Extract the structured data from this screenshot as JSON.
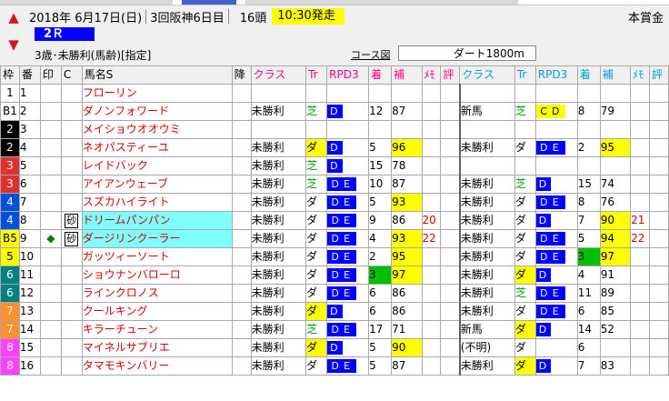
{
  "header": {
    "date": "2018年 6月17日(日)",
    "meeting": "3回阪神6日目",
    "heads": "16頭",
    "start_time": "10:30発走",
    "prize": "本賞金",
    "race_number": "2Ｒ",
    "condition": "3歳･未勝利(馬齢)[指定]",
    "course_label": "コース図",
    "course": "ダート1800m"
  },
  "columns": {
    "waku": "枠",
    "ban": "番",
    "mark": "印",
    "c": "C",
    "name": "馬名S",
    "kou": "降",
    "class1": "クラス",
    "tr1": "Tr",
    "rd1": "RPD3",
    "chaku1": "着",
    "ho1": "補",
    "memo1": "ﾒﾓ",
    "hyo1": "評",
    "class2": "クラス",
    "tr2": "Tr",
    "rd2": "RPD3",
    "chaku2": "着",
    "ho2": "補",
    "memo2": "ﾒﾓ",
    "hyo2": "評"
  },
  "colors": {
    "waku": [
      "#ffffff",
      "#000000",
      "#e03030",
      "#0050e0",
      "#ffff00",
      "#008080",
      "#ff9030",
      "#ff40ff"
    ],
    "waku_text": [
      "#000000",
      "#ffffff",
      "#ffffff",
      "#ffffff",
      "#000000",
      "#ffffff",
      "#ffffff",
      "#ffffff"
    ]
  },
  "rows": [
    {
      "waku": "1",
      "wc": 0,
      "ban": "1",
      "mark": "",
      "c": "",
      "name": "フローリン",
      "hl": false,
      "r1": {
        "cls": "",
        "tr": "",
        "trc": "",
        "rd": "",
        "chaku": "",
        "ho": "",
        "memo": ""
      },
      "r2": {
        "cls": "",
        "tr": "",
        "trc": "",
        "rd": "",
        "chaku": "",
        "ho": "",
        "memo": ""
      }
    },
    {
      "waku": "B1",
      "wc": 0,
      "ban": "2",
      "mark": "",
      "c": "",
      "name": "ダノンフォワード",
      "hl": false,
      "r1": {
        "cls": "未勝利",
        "tr": "芝",
        "trc": "shiba",
        "rd": "D",
        "chaku": "12",
        "ho": "87",
        "memo": ""
      },
      "r2": {
        "cls": "新馬",
        "tr": "芝",
        "trc": "shiba",
        "rd": "ＣＤ",
        "rdy": true,
        "chaku": "8",
        "ho": "79",
        "memo": ""
      }
    },
    {
      "waku": "2",
      "wc": 1,
      "ban": "3",
      "mark": "",
      "c": "",
      "name": "メイショウオオウミ",
      "hl": false,
      "r1": {
        "cls": "",
        "tr": "",
        "trc": "",
        "rd": "",
        "chaku": "",
        "ho": "",
        "memo": ""
      },
      "r2": {
        "cls": "",
        "tr": "",
        "trc": "",
        "rd": "",
        "chaku": "",
        "ho": "",
        "memo": ""
      }
    },
    {
      "waku": "2",
      "wc": 1,
      "ban": "4",
      "mark": "",
      "c": "",
      "name": "ネオパスティーユ",
      "hl": false,
      "r1": {
        "cls": "未勝利",
        "tr": "ダ",
        "trc": "yel",
        "rd": "D",
        "chaku": "5",
        "ho": "96",
        "hoy": true,
        "memo": ""
      },
      "r2": {
        "cls": "未勝利",
        "tr": "ダ",
        "trc": "da",
        "rd": "ＤＥ",
        "chaku": "2",
        "ho": "95",
        "hoy": true,
        "memo": ""
      }
    },
    {
      "waku": "3",
      "wc": 2,
      "ban": "5",
      "mark": "",
      "c": "",
      "name": "レイドバック",
      "hl": false,
      "r1": {
        "cls": "未勝利",
        "tr": "芝",
        "trc": "shiba",
        "rd": "D",
        "chaku": "15",
        "ho": "78",
        "memo": ""
      },
      "r2": {
        "cls": "",
        "tr": "",
        "trc": "",
        "rd": "",
        "chaku": "",
        "ho": "",
        "memo": ""
      }
    },
    {
      "waku": "3",
      "wc": 2,
      "ban": "6",
      "mark": "",
      "c": "",
      "name": "アイアンウェーブ",
      "hl": false,
      "r1": {
        "cls": "未勝利",
        "tr": "芝",
        "trc": "shiba",
        "rd": "ＤＥ",
        "chaku": "10",
        "ho": "87",
        "memo": ""
      },
      "r2": {
        "cls": "未勝利",
        "tr": "芝",
        "trc": "shiba",
        "rd": "D",
        "chaku": "15",
        "ho": "74",
        "memo": ""
      }
    },
    {
      "waku": "4",
      "wc": 3,
      "ban": "7",
      "mark": "",
      "c": "",
      "name": "スズカハイライト",
      "hl": false,
      "r1": {
        "cls": "未勝利",
        "tr": "ダ",
        "trc": "da",
        "rd": "ＤＥ",
        "chaku": "5",
        "ho": "93",
        "hoy": true,
        "memo": ""
      },
      "r2": {
        "cls": "未勝利",
        "tr": "ダ",
        "trc": "da",
        "rd": "ＤＥ",
        "chaku": "8",
        "ho": "76",
        "memo": ""
      }
    },
    {
      "waku": "4",
      "wc": 3,
      "ban": "8",
      "mark": "",
      "c": "砂",
      "name": "ドリームパンパン",
      "hl": true,
      "r1": {
        "cls": "未勝利",
        "tr": "ダ",
        "trc": "da",
        "rd": "ＤＥ",
        "chaku": "9",
        "ho": "86",
        "memo": "20"
      },
      "r2": {
        "cls": "未勝利",
        "tr": "ダ",
        "trc": "da",
        "rd": "D",
        "chaku": "7",
        "ho": "90",
        "hoy": true,
        "memo": "21"
      }
    },
    {
      "waku": "B5",
      "wc": 4,
      "ban": "9",
      "mark": "◆",
      "c": "砂",
      "name": "ダージリンクーラー",
      "hl": true,
      "r1": {
        "cls": "未勝利",
        "tr": "ダ",
        "trc": "da",
        "rd": "ＤＥ",
        "chaku": "4",
        "ho": "93",
        "hoy": true,
        "memo": "22"
      },
      "r2": {
        "cls": "未勝利",
        "tr": "ダ",
        "trc": "da",
        "rd": "ＤＥ",
        "chaku": "5",
        "ho": "94",
        "hoy": true,
        "memo": "22"
      }
    },
    {
      "waku": "5",
      "wc": 4,
      "ban": "10",
      "mark": "",
      "c": "",
      "name": "ガッツィーソート",
      "hl": false,
      "r1": {
        "cls": "未勝利",
        "tr": "ダ",
        "trc": "da",
        "rd": "ＤＥ",
        "chaku": "2",
        "ho": "95",
        "hoy": true,
        "memo": ""
      },
      "r2": {
        "cls": "未勝利",
        "tr": "ダ",
        "trc": "da",
        "rd": "ＤＥ",
        "chaku": "3",
        "chg": true,
        "ho": "97",
        "hoy": true,
        "memo": ""
      }
    },
    {
      "waku": "6",
      "wc": 5,
      "ban": "11",
      "mark": "",
      "c": "",
      "name": "ショウナンバローロ",
      "hl": false,
      "r1": {
        "cls": "未勝利",
        "tr": "ダ",
        "trc": "da",
        "rd": "ＤＥ",
        "chaku": "3",
        "chg": true,
        "ho": "97",
        "hoy": true,
        "memo": ""
      },
      "r2": {
        "cls": "未勝利",
        "tr": "ダ",
        "trc": "yel",
        "rd": "D",
        "chaku": "4",
        "ho": "91",
        "memo": ""
      }
    },
    {
      "waku": "6",
      "wc": 5,
      "ban": "12",
      "mark": "",
      "c": "",
      "name": "ラインクロノス",
      "hl": false,
      "r1": {
        "cls": "未勝利",
        "tr": "ダ",
        "trc": "da",
        "rd": "ＤＥ",
        "chaku": "6",
        "ho": "86",
        "memo": ""
      },
      "r2": {
        "cls": "未勝利",
        "tr": "芝",
        "trc": "shiba",
        "rd": "ＤＥ",
        "chaku": "11",
        "ho": "89",
        "memo": ""
      }
    },
    {
      "waku": "7",
      "wc": 6,
      "ban": "13",
      "mark": "",
      "c": "",
      "name": "クールキング",
      "hl": false,
      "r1": {
        "cls": "未勝利",
        "tr": "ダ",
        "trc": "yel",
        "rd": "D",
        "chaku": "6",
        "ho": "86",
        "memo": ""
      },
      "r2": {
        "cls": "未勝利",
        "tr": "ダ",
        "trc": "da",
        "rd": "ＤＥ",
        "chaku": "6",
        "ho": "85",
        "memo": ""
      }
    },
    {
      "waku": "7",
      "wc": 6,
      "ban": "14",
      "mark": "",
      "c": "",
      "name": "キラーチューン",
      "hl": false,
      "r1": {
        "cls": "未勝利",
        "tr": "芝",
        "trc": "shiba",
        "rd": "ＤＥ",
        "chaku": "17",
        "ho": "71",
        "memo": ""
      },
      "r2": {
        "cls": "新馬",
        "tr": "ダ",
        "trc": "yel",
        "rd": "D",
        "chaku": "14",
        "ho": "52",
        "memo": ""
      }
    },
    {
      "waku": "8",
      "wc": 7,
      "ban": "15",
      "mark": "",
      "c": "",
      "name": "マイネルサブリエ",
      "hl": false,
      "r1": {
        "cls": "未勝利",
        "tr": "ダ",
        "trc": "yel",
        "rd": "D",
        "chaku": "5",
        "ho": "90",
        "hoy": true,
        "memo": ""
      },
      "r2": {
        "cls": "(不明)",
        "tr": "ダ",
        "trc": "da",
        "rd": "",
        "chaku": "6",
        "ho": "",
        "memo": ""
      }
    },
    {
      "waku": "8",
      "wc": 7,
      "ban": "16",
      "mark": "",
      "c": "",
      "name": "タマモキンバリー",
      "hl": false,
      "r1": {
        "cls": "未勝利",
        "tr": "ダ",
        "trc": "da",
        "rd": "ＤＥ",
        "chaku": "5",
        "ho": "87",
        "memo": ""
      },
      "r2": {
        "cls": "未勝利",
        "tr": "ダ",
        "trc": "yel",
        "rd": "D",
        "chaku": "7",
        "ho": "83",
        "memo": ""
      }
    }
  ]
}
